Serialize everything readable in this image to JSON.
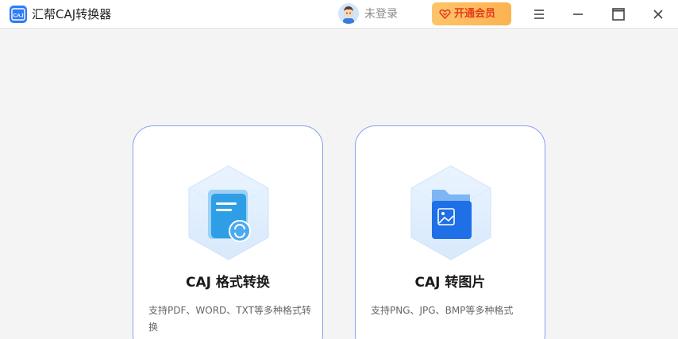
{
  "app": {
    "title": "汇帮CAJ转换器",
    "logo_text": "CAJ"
  },
  "header": {
    "login_text": "未登录",
    "vip_label": "开通会员"
  },
  "colors": {
    "accent": "#2f7cf6",
    "vip_bg": "#fdb24f",
    "vip_text": "#e53b1f",
    "card_border": "#8aa0f0"
  },
  "cards": [
    {
      "title": "CAJ 格式转换",
      "desc": "支持PDF、WORD、TXT等多种格式转换",
      "icon": "document-convert-icon"
    },
    {
      "title": "CAJ 转图片",
      "desc": "支持PNG、JPG、BMP等多种格式",
      "icon": "image-folder-icon"
    }
  ],
  "window_controls": [
    "menu-icon",
    "minimize-icon",
    "maximize-icon",
    "close-icon"
  ]
}
